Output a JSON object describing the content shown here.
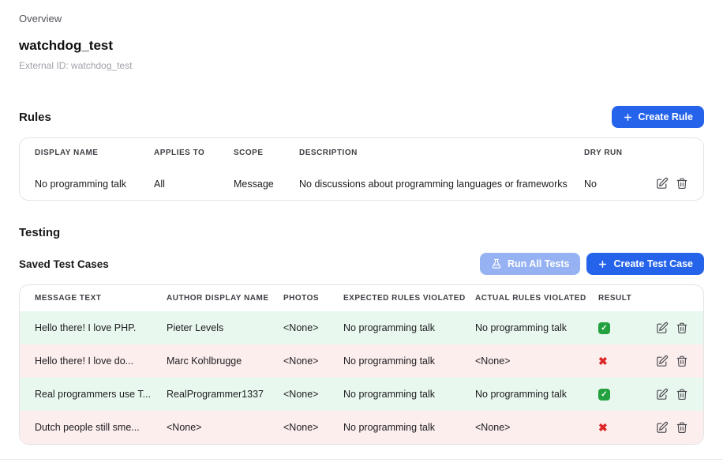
{
  "page": {
    "breadcrumb": "Overview",
    "title": "watchdog_test",
    "external_id": "External ID: watchdog_test"
  },
  "rules": {
    "heading": "Rules",
    "create_button": "Create Rule",
    "columns": [
      "Display Name",
      "Applies To",
      "Scope",
      "Description",
      "Dry Run"
    ],
    "rows": [
      {
        "display_name": "No programming talk",
        "applies_to": "All",
        "scope": "Message",
        "description": "No discussions about programming languages or frameworks",
        "dry_run": "No"
      }
    ]
  },
  "testing": {
    "heading": "Testing",
    "subheading": "Saved Test Cases",
    "run_all_button": "Run All Tests",
    "create_button": "Create Test Case",
    "columns": [
      "Message Text",
      "Author Display Name",
      "Photos",
      "Expected Rules Violated",
      "Actual Rules Violated",
      "Result"
    ],
    "rows": [
      {
        "message": "Hello there! I love PHP.",
        "author": "Pieter Levels",
        "photos": "<None>",
        "expected": "No programming talk",
        "actual": "No programming talk",
        "result": "pass"
      },
      {
        "message": "Hello there! I love do...",
        "author": "Marc Kohlbrugge",
        "photos": "<None>",
        "expected": "No programming talk",
        "actual": "<None>",
        "result": "fail"
      },
      {
        "message": "Real programmers use T...",
        "author": "RealProgrammer1337",
        "photos": "<None>",
        "expected": "No programming talk",
        "actual": "No programming talk",
        "result": "pass"
      },
      {
        "message": "Dutch people still sme...",
        "author": "<None>",
        "photos": "<None>",
        "expected": "No programming talk",
        "actual": "<None>",
        "result": "fail"
      }
    ]
  },
  "icons": {
    "edit": "pencil-square",
    "delete": "trash",
    "run": "flask",
    "add": "plus",
    "pass": "green-check",
    "fail": "red-x"
  },
  "colors": {
    "accent": "#2563eb",
    "accent_disabled": "#96b2f2",
    "pass_row_bg": "#e9f8ef",
    "fail_row_bg": "#fdeeee",
    "pass_icon": "#22a13e",
    "fail_icon": "#dc2626"
  }
}
